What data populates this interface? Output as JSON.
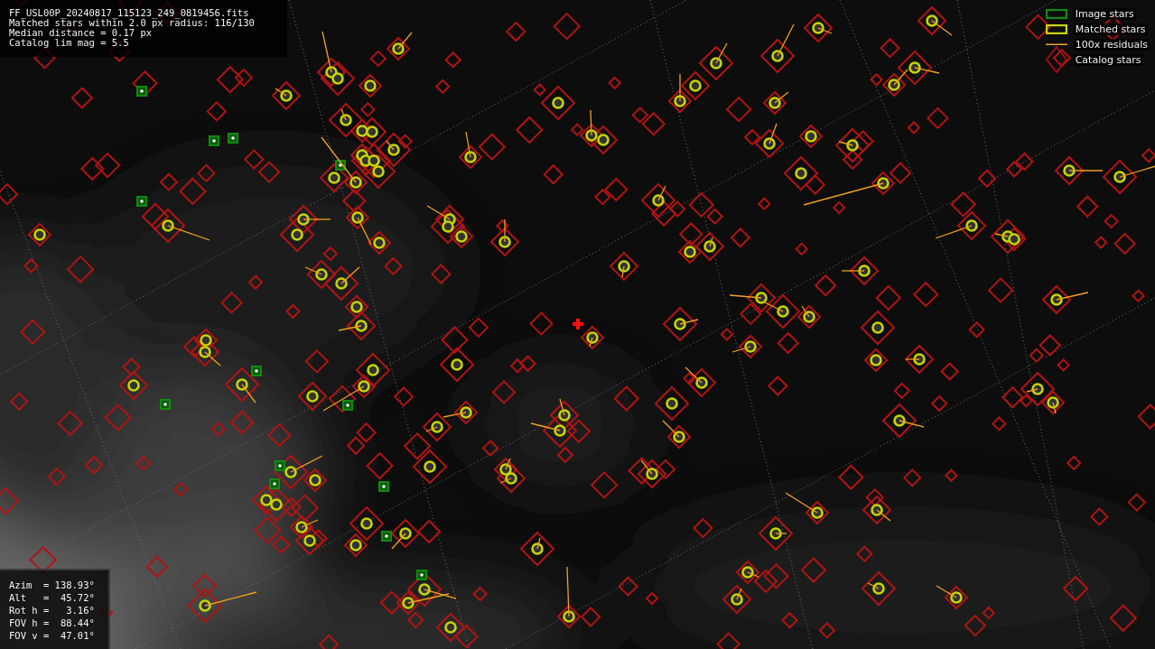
{
  "info": {
    "lines": [
      "FF_USL00P_20240817_115123_249_0819456.fits",
      "Matched stars within 2.0 px radius: 116/130",
      "Median distance = 0.17 px",
      "Catalog lim mag = 5.5"
    ]
  },
  "legend": [
    {
      "kind": "image",
      "label": "Image stars"
    },
    {
      "kind": "matched",
      "label": "Matched stars"
    },
    {
      "kind": "residual",
      "label": "100x residuals"
    },
    {
      "kind": "catalog",
      "label": "Catalog stars"
    }
  ],
  "pointing": {
    "lines": [
      "Azim  = 138.93°",
      "Alt   =  45.72°",
      "Rot h =   3.16°",
      "FOV h =  88.44°",
      "FOV v =  47.01°"
    ]
  }
}
